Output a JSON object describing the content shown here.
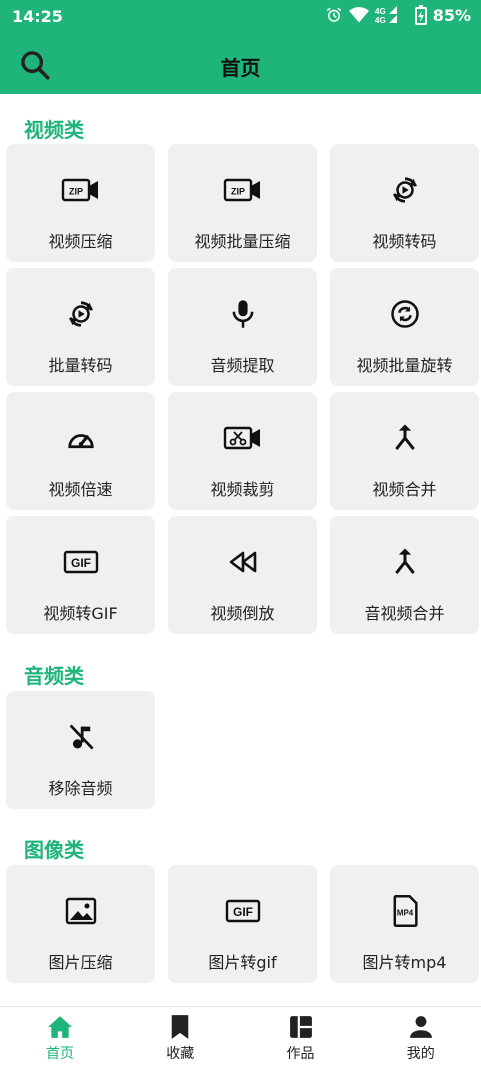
{
  "status": {
    "time": "14:25",
    "network": "4G",
    "battery": "85%"
  },
  "header": {
    "title": "首页"
  },
  "sections": {
    "video": {
      "title": "视频类",
      "items": [
        {
          "label": "视频压缩",
          "icon": "zip-video-icon"
        },
        {
          "label": "视频批量压缩",
          "icon": "zip-video-icon"
        },
        {
          "label": "视频转码",
          "icon": "convert-play-icon"
        },
        {
          "label": "批量转码",
          "icon": "convert-play-icon"
        },
        {
          "label": "音频提取",
          "icon": "microphone-icon"
        },
        {
          "label": "视频批量旋转",
          "icon": "rotate-icon"
        },
        {
          "label": "视频倍速",
          "icon": "speedometer-icon"
        },
        {
          "label": "视频裁剪",
          "icon": "scissors-video-icon"
        },
        {
          "label": "视频合并",
          "icon": "merge-icon"
        },
        {
          "label": "视频转GIF",
          "icon": "gif-icon"
        },
        {
          "label": "视频倒放",
          "icon": "rewind-icon"
        },
        {
          "label": "音视频合并",
          "icon": "merge-icon"
        }
      ]
    },
    "audio": {
      "title": "音频类",
      "items": [
        {
          "label": "移除音频",
          "icon": "music-off-icon"
        }
      ]
    },
    "image": {
      "title": "图像类",
      "items": [
        {
          "label": "图片压缩",
          "icon": "image-icon"
        },
        {
          "label": "图片转gif",
          "icon": "gif-icon"
        },
        {
          "label": "图片转mp4",
          "icon": "mp4-file-icon"
        }
      ]
    }
  },
  "icon_text": {
    "zip": "ZIP",
    "gif": "GIF",
    "mp4": "MP4"
  },
  "bottom_nav": [
    {
      "label": "首页",
      "icon": "home-icon",
      "active": true
    },
    {
      "label": "收藏",
      "icon": "bookmark-icon",
      "active": false
    },
    {
      "label": "作品",
      "icon": "dashboard-icon",
      "active": false
    },
    {
      "label": "我的",
      "icon": "person-icon",
      "active": false
    }
  ],
  "colors": {
    "accent": "#1fb57a",
    "tile": "#f0f0f0"
  }
}
